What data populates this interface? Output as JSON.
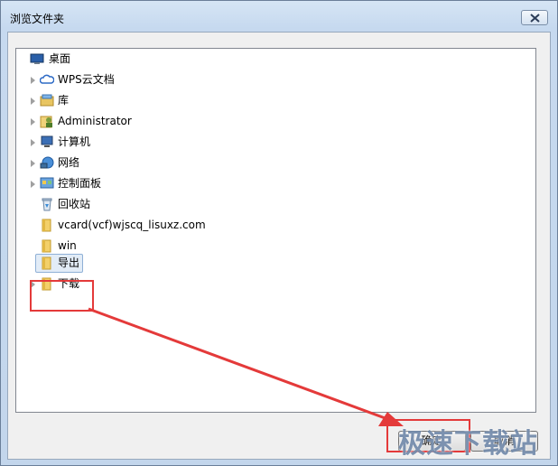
{
  "window": {
    "title": "浏览文件夹"
  },
  "tree": {
    "items": [
      {
        "label": "桌面",
        "icon": "desktop-icon",
        "expander": false
      },
      {
        "label": "WPS云文档",
        "icon": "cloud-icon",
        "expander": true
      },
      {
        "label": "库",
        "icon": "library-icon",
        "expander": true
      },
      {
        "label": "Administrator",
        "icon": "user-folder-icon",
        "expander": true
      },
      {
        "label": "计算机",
        "icon": "computer-icon",
        "expander": true
      },
      {
        "label": "网络",
        "icon": "network-icon",
        "expander": true
      },
      {
        "label": "控制面板",
        "icon": "control-panel-icon",
        "expander": true
      },
      {
        "label": "回收站",
        "icon": "recycle-bin-icon",
        "expander": false
      },
      {
        "label": "vcard(vcf)wjscq_lisuxz.com",
        "icon": "folder-icon",
        "expander": false
      },
      {
        "label": "win",
        "icon": "folder-icon",
        "expander": false
      },
      {
        "label": "导出",
        "icon": "folder-icon",
        "expander": false,
        "selected": true
      },
      {
        "label": "下载",
        "icon": "folder-icon",
        "expander": true
      }
    ]
  },
  "buttons": {
    "ok": "确定",
    "cancel": "取消"
  },
  "watermark": "极速下载站",
  "annotation_color": "#e43a3a"
}
